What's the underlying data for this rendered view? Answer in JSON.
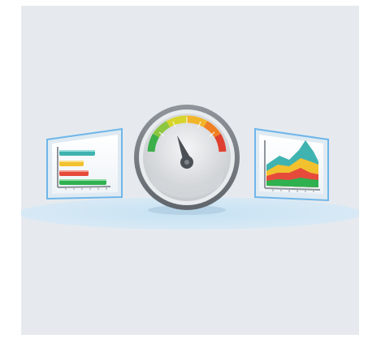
{
  "illustration": {
    "icons": [
      {
        "name": "bar-chart-icon"
      },
      {
        "name": "speedometer-icon"
      },
      {
        "name": "area-chart-icon"
      }
    ],
    "colors": {
      "background": "#e6eaee",
      "frame_blue": "#5aa9e6",
      "floor_blue": "#bfdcef",
      "bar_teal": "#3fb3b0",
      "bar_yellow": "#f2c12e",
      "bar_red": "#e64a3b",
      "bar_green": "#2fb14f",
      "gauge_gray": "#8a8f95"
    }
  }
}
